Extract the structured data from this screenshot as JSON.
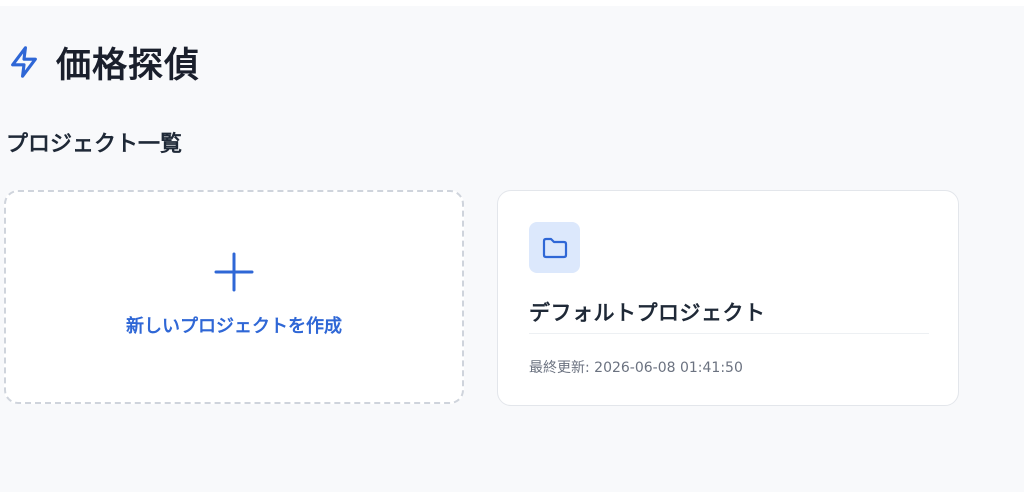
{
  "app": {
    "title": "価格探偵",
    "icon": "lightning-bolt-icon"
  },
  "projects_section": {
    "title": "プロジェクト一覧",
    "create_card": {
      "icon": "plus-icon",
      "label": "新しいプロジェクトを作成"
    },
    "projects": [
      {
        "icon": "folder-icon",
        "name": "デフォルトプロジェクト",
        "updated_label": "最終更新: 2026-06-08 01:41:50"
      }
    ]
  },
  "colors": {
    "accent": "#2f67d6",
    "background": "#f8f9fb",
    "card": "#ffffff",
    "icon_bg": "#dce8fc"
  }
}
